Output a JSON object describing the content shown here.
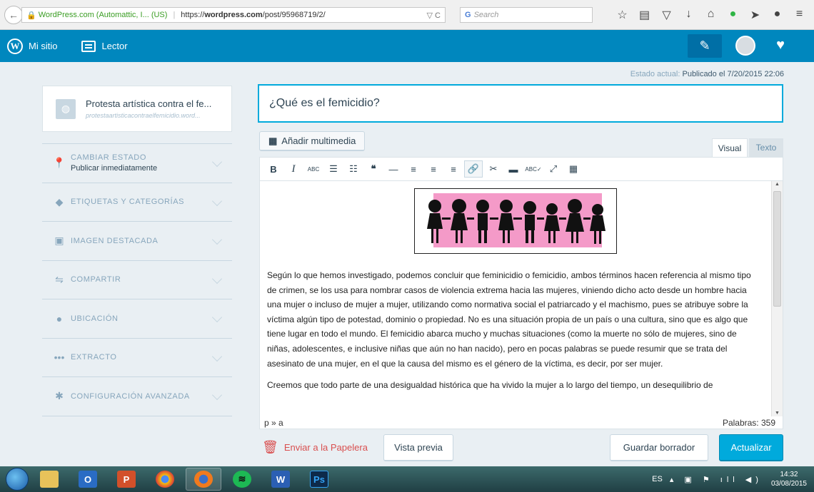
{
  "browser": {
    "site_identity": "WordPress.com (Automattic, I... (US)",
    "url_prefix": "https://",
    "url_host": "wordpress.com",
    "url_path": "/post/95968719/2/",
    "url_controls": "▽ C",
    "search_placeholder": "Search"
  },
  "masterbar": {
    "my_site": "Mi sitio",
    "reader": "Lector"
  },
  "status": {
    "label": "Estado actual:",
    "value": "Publicado el 7/20/2015 22:06"
  },
  "sidebar": {
    "site_title": "Protesta artística contra el fe...",
    "site_url": "protestaartisticacontraelfemicidio.word...",
    "items": [
      {
        "label": "CAMBIAR ESTADO",
        "sub": "Publicar inmediatamente",
        "icon": "pin-icon"
      },
      {
        "label": "ETIQUETAS Y CATEGORÍAS",
        "icon": "tag-icon"
      },
      {
        "label": "IMAGEN DESTACADA",
        "icon": "image-icon"
      },
      {
        "label": "COMPARTIR",
        "icon": "share-icon"
      },
      {
        "label": "UBICACIÓN",
        "icon": "location-icon"
      },
      {
        "label": "EXTRACTO",
        "icon": "ellipsis-icon"
      },
      {
        "label": "CONFIGURACIÓN AVANZADA",
        "icon": "cog-icon"
      }
    ]
  },
  "editor": {
    "title": "¿Qué es el femicidio?",
    "add_media": "Añadir multimedia",
    "tab_visual": "Visual",
    "tab_text": "Texto",
    "paragraphs": [
      "Según lo que hemos investigado, podemos concluir que feminicidio o femicidio, ambos términos hacen referencia al mismo tipo de crimen, se los usa para nombrar casos de violencia extrema hacia las mujeres, viniendo dicho acto desde un hombre hacia una mujer o incluso de mujer a mujer, utilizando como normativa social el patriarcado y el machismo, pues se atribuye sobre la víctima algún tipo de potestad, dominio o propiedad. No es una situación propia de un país o una cultura, sino que es algo que tiene lugar en todo el mundo. El femicidio abarca mucho y muchas situaciones (como la muerte no sólo de mujeres, sino de niñas, adolescentes, e inclusive niñas que aún no han nacido), pero en pocas palabras se puede resumir que se trata del asesinato de una mujer, en el que la causa del mismo es el género de la víctima, es decir, por ser mujer.",
      "Creemos que todo parte de una desigualdad histórica que ha vivido la mujer a lo largo del tiempo, un desequilibrio de"
    ],
    "path": "p » a",
    "word_count": "Palabras: 359"
  },
  "actions": {
    "trash": "Enviar a la Papelera",
    "preview": "Vista previa",
    "save_draft": "Guardar borrador",
    "update": "Actualizar"
  },
  "taskbar": {
    "language": "ES",
    "time": "14:32",
    "date": "03/08/2015"
  },
  "colors": {
    "masterbar": "#0087be",
    "accent": "#00aadc",
    "trash": "#d94f4f"
  }
}
